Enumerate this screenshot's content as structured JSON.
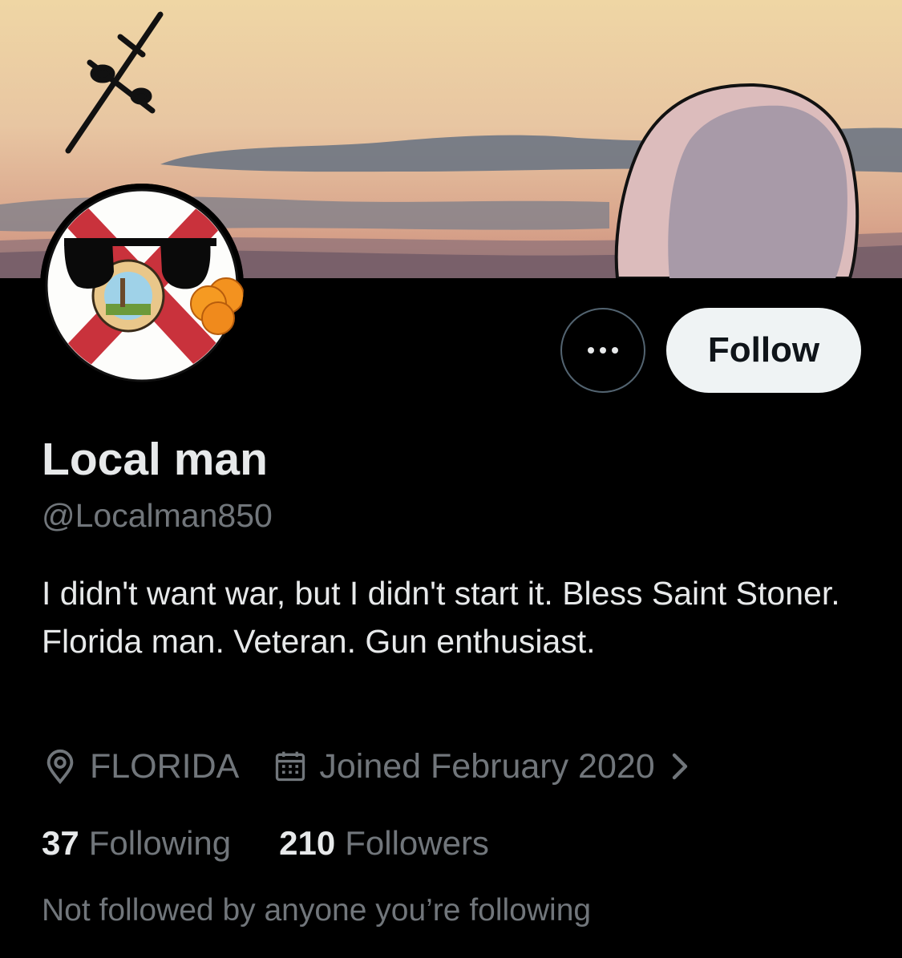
{
  "profile": {
    "name": "Local man",
    "handle": "@Localman850",
    "bio_lines": [
      "I didn't want war, but I didn't start it. Bless Saint Stoner.",
      "Florida man. Veteran. Gun enthusiast."
    ],
    "location": "FLORIDA",
    "joined": "Joined February 2020"
  },
  "actions": {
    "follow_label": "Follow",
    "more_icon": "ellipsis-icon"
  },
  "stats": {
    "following_count": "37",
    "following_label": "Following",
    "followers_count": "210",
    "followers_label": "Followers"
  },
  "social_context": "Not followed by anyone you’re following",
  "icons": {
    "location": "location-pin-icon",
    "calendar": "calendar-icon",
    "chevron": "chevron-right-icon"
  },
  "colors": {
    "background": "#000000",
    "primary_text": "#e7e9ea",
    "secondary_text": "#71767b",
    "follow_button_bg": "#eff3f4"
  }
}
